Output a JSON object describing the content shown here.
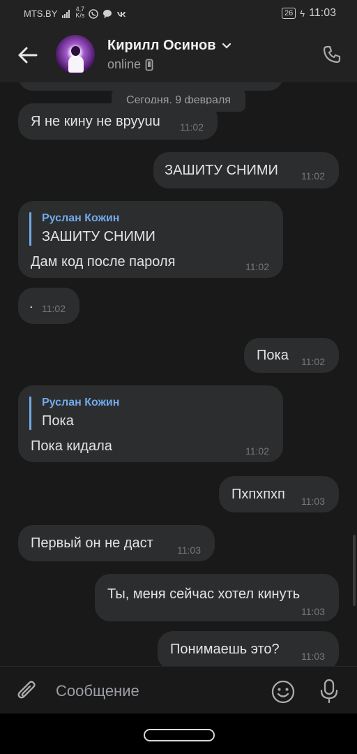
{
  "status_bar": {
    "carrier": "MTS.BY",
    "speed_value": "4,7",
    "speed_unit": "K/s",
    "battery": "26",
    "time": "11:03"
  },
  "header": {
    "contact_name": "Кирилл Осинов",
    "status": "online",
    "icons": [
      "back-arrow-icon",
      "chevron-down-icon",
      "phone-device-icon",
      "phone-call-icon"
    ]
  },
  "chat": {
    "date_divider": "Сегодня, 9 февраля",
    "messages": [
      {
        "dir": "in",
        "text": "Я не кину не врууuu",
        "time": "11:02"
      },
      {
        "dir": "out",
        "text": "ЗАШИТУ СНИМИ",
        "time": "11:02"
      },
      {
        "dir": "in",
        "reply_author": "Руслан Кожин",
        "reply_text": "ЗАШИТУ СНИМИ",
        "text": "Дам код после пароля",
        "time": "11:02"
      },
      {
        "dir": "in",
        "text": ".",
        "time": "11:02"
      },
      {
        "dir": "out",
        "text": "Пока",
        "time": "11:02"
      },
      {
        "dir": "in",
        "reply_author": "Руслан Кожин",
        "reply_text": "Пока",
        "text": "Пока кидала",
        "time": "11:02"
      },
      {
        "dir": "out",
        "text": "Пхпхпхп",
        "time": "11:03"
      },
      {
        "dir": "in",
        "text": "Первый он не даст",
        "time": "11:03"
      },
      {
        "dir": "out",
        "text": "Ты, меня сейчас хотел кинуть",
        "time": "11:03"
      },
      {
        "dir": "out",
        "text": "Понимаешь это?",
        "time": "11:03"
      }
    ]
  },
  "composer": {
    "placeholder": "Сообщение",
    "icons": [
      "paperclip-icon",
      "emoji-icon",
      "microphone-icon"
    ]
  },
  "colors": {
    "background": "#191919",
    "bubble": "#2c2d2e",
    "accent": "#71aaeb",
    "header": "#222222"
  }
}
